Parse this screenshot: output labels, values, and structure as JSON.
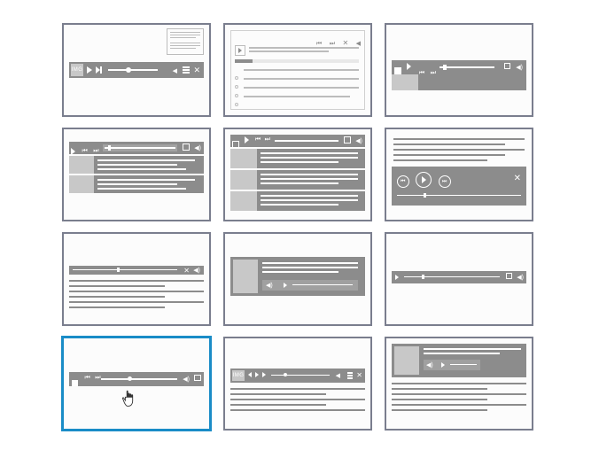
{
  "grid": {
    "templates": [
      {
        "id": "t1",
        "selected": false
      },
      {
        "id": "t2",
        "selected": false
      },
      {
        "id": "t3",
        "selected": false
      },
      {
        "id": "t4",
        "selected": false
      },
      {
        "id": "t5",
        "selected": false
      },
      {
        "id": "t6",
        "selected": false
      },
      {
        "id": "t7",
        "selected": false
      },
      {
        "id": "t8",
        "selected": false
      },
      {
        "id": "t9",
        "selected": false
      },
      {
        "id": "t10",
        "selected": true
      },
      {
        "id": "t11",
        "selected": false
      },
      {
        "id": "t12",
        "selected": false
      }
    ]
  },
  "labels": {
    "img": "IMG"
  },
  "icons": {
    "play": "play-icon",
    "prev": "prev-icon",
    "next": "next-icon",
    "stop": "stop-icon",
    "pause": "pause-icon",
    "shuffle": "shuffle-icon",
    "menu": "menu-icon",
    "volume": "volume-icon",
    "fullscreen": "fullscreen-icon",
    "screen": "screen-icon"
  },
  "colors": {
    "border": "#7a7e8e",
    "selected_border": "#1a8cc7",
    "fill_gray": "#8c8c8c",
    "fill_dark": "#707070",
    "fill_light": "#c8c8c8"
  }
}
